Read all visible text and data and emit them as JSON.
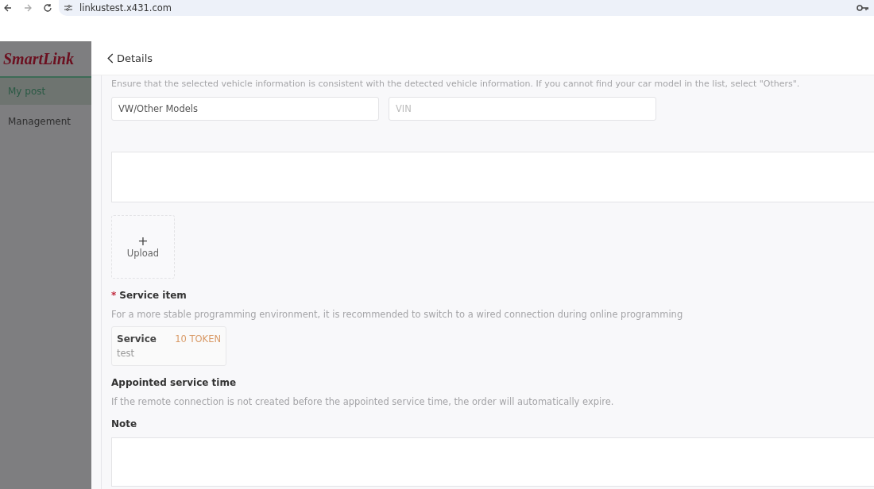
{
  "browser": {
    "url": "linkustest.x431.com"
  },
  "sidebar": {
    "logo": "SmartLink",
    "items": [
      {
        "label": "My post",
        "selected": true
      },
      {
        "label": "Management",
        "selected": false
      }
    ]
  },
  "drawer": {
    "title": "Details",
    "vehicle_hint": "Ensure that the selected vehicle information is consistent with the detected vehicle information. If you cannot find your car model in the list, select \"Others\".",
    "vehicle_fields": [
      {
        "value": "VW/Other Models"
      },
      {
        "placeholder": "VIN"
      }
    ],
    "upload": {
      "icon": "+",
      "label": "Upload"
    },
    "service_item": {
      "label": "Service item",
      "required_mark": "*",
      "hint": "For a more stable programming environment, it is recommended to switch to a wired connection during online programming",
      "cards": [
        {
          "name": "Service",
          "price": "10 TOKEN",
          "description": "test"
        }
      ]
    },
    "appointed": {
      "label": "Appointed service time",
      "hint": "If the remote connection is not created before the appointed service time, the order will automatically expire."
    },
    "note": {
      "label": "Note"
    }
  }
}
